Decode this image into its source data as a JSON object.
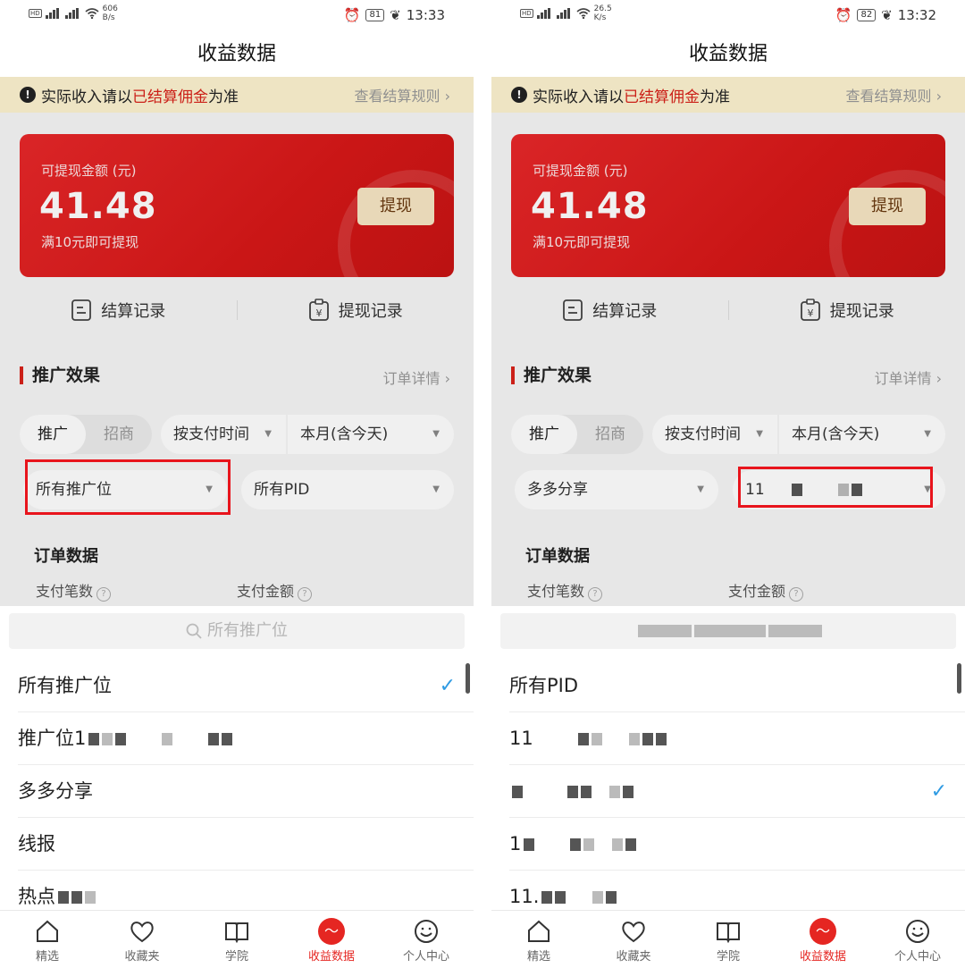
{
  "phones": [
    {
      "status": {
        "speed": "606",
        "speed_unit": "B/s",
        "battery": "81",
        "time": "13:33"
      },
      "title": "收益数据",
      "notice": {
        "prefix": "实际收入请以",
        "highlight": "已结算佣金",
        "suffix": "为准",
        "link": "查看结算规则"
      },
      "card": {
        "label": "可提现金额 (元)",
        "amount": "41.48",
        "hint": "满10元即可提现",
        "button": "提现"
      },
      "records": {
        "settle": "结算记录",
        "withdraw": "提现记录"
      },
      "section": {
        "title": "推广效果",
        "link": "订单详情"
      },
      "segments": {
        "active": "推广",
        "inactive": "招商"
      },
      "filters": {
        "time_type": "按支付时间",
        "period": "本月(含今天)",
        "position": "所有推广位",
        "pid": "所有PID"
      },
      "order": {
        "title": "订单数据",
        "count_label": "支付笔数",
        "amount_label": "支付金额"
      },
      "sheet": {
        "search_placeholder": "所有推广位",
        "options": [
          {
            "label": "所有推广位",
            "checked": true
          },
          {
            "label": "推广位1",
            "checked": false
          },
          {
            "label": "多多分享",
            "checked": false
          },
          {
            "label": "线报",
            "checked": false
          },
          {
            "label": "热点",
            "checked": false
          }
        ]
      }
    },
    {
      "status": {
        "speed": "26.5",
        "speed_unit": "K/s",
        "battery": "82",
        "time": "13:32"
      },
      "title": "收益数据",
      "notice": {
        "prefix": "实际收入请以",
        "highlight": "已结算佣金",
        "suffix": "为准",
        "link": "查看结算规则"
      },
      "card": {
        "label": "可提现金额 (元)",
        "amount": "41.48",
        "hint": "满10元即可提现",
        "button": "提现"
      },
      "records": {
        "settle": "结算记录",
        "withdraw": "提现记录"
      },
      "section": {
        "title": "推广效果",
        "link": "订单详情"
      },
      "segments": {
        "active": "推广",
        "inactive": "招商"
      },
      "filters": {
        "time_type": "按支付时间",
        "period": "本月(含今天)",
        "position": "多多分享",
        "pid": "11"
      },
      "order": {
        "title": "订单数据",
        "count_label": "支付笔数",
        "amount_label": "支付金额"
      },
      "sheet": {
        "search_placeholder": "",
        "options": [
          {
            "label": "所有PID",
            "checked": false
          },
          {
            "label": "11",
            "checked": false
          },
          {
            "label": "",
            "checked": true
          },
          {
            "label": "1",
            "checked": false
          },
          {
            "label": "11.",
            "checked": false
          }
        ]
      }
    }
  ],
  "tabbar": [
    {
      "label": "精选",
      "icon": "home-icon"
    },
    {
      "label": "收藏夹",
      "icon": "heart-icon"
    },
    {
      "label": "学院",
      "icon": "book-icon"
    },
    {
      "label": "收益数据",
      "icon": "earnings-icon"
    },
    {
      "label": "个人中心",
      "icon": "smile-icon"
    }
  ],
  "colors": {
    "accent": "#e52622",
    "notice_red": "#d8221a",
    "check_blue": "#2f9be3",
    "highlight_box": "#e8141c"
  }
}
